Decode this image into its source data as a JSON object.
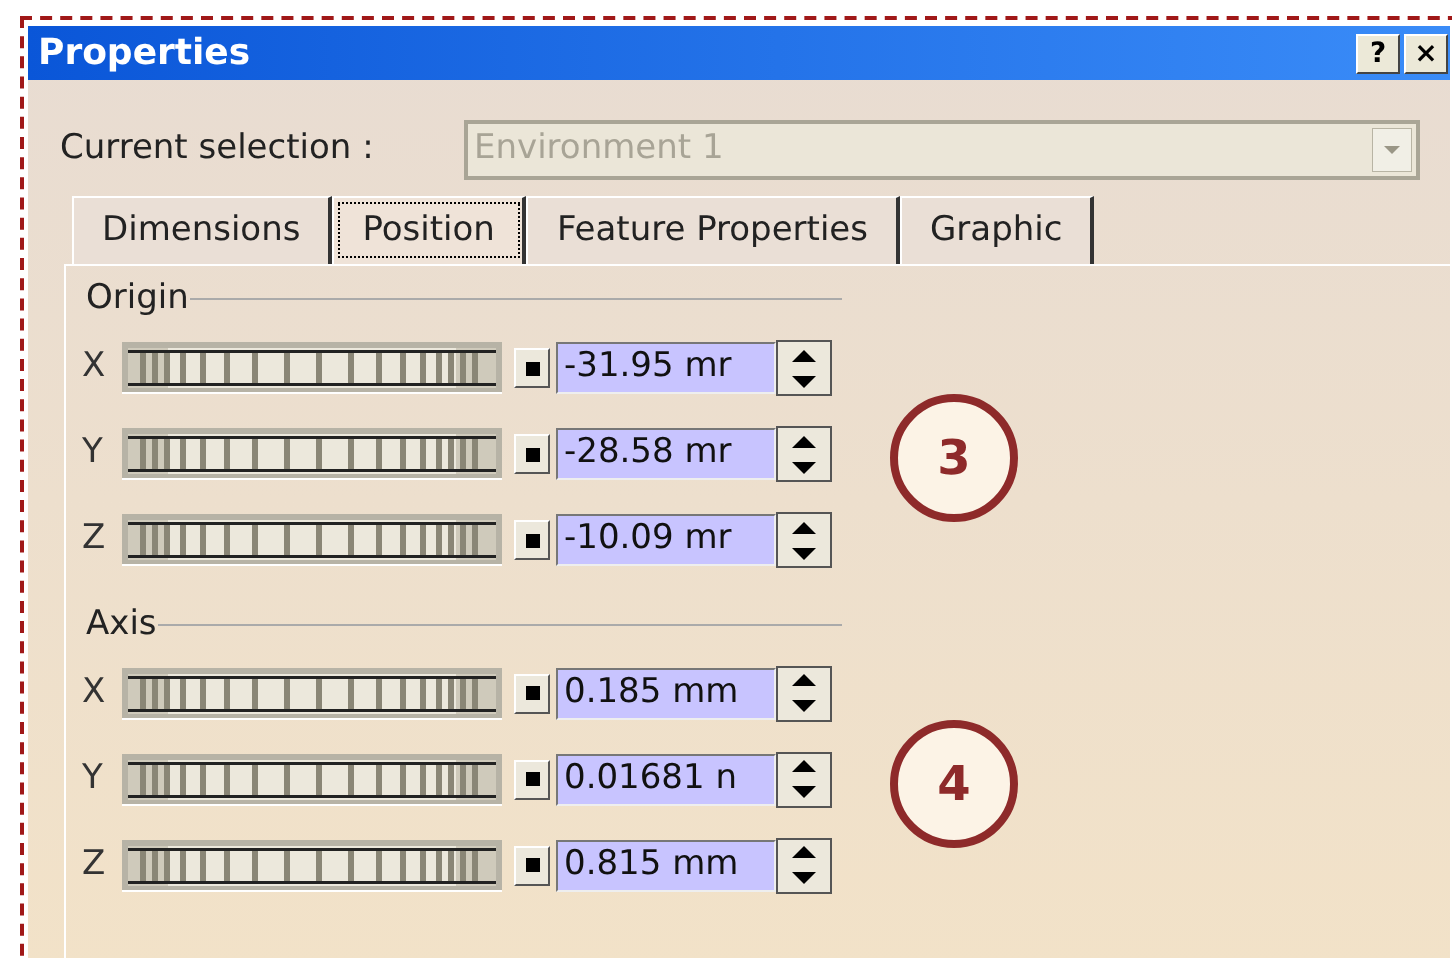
{
  "window": {
    "title": "Properties",
    "buttons": [
      "?",
      "×"
    ]
  },
  "current_selection": {
    "label": "Current selection :",
    "value": "Environment 1",
    "disabled": true
  },
  "tabs": [
    {
      "label": "Dimensions",
      "selected": false
    },
    {
      "label": "Position",
      "selected": true
    },
    {
      "label": "Feature Properties",
      "selected": false
    },
    {
      "label": "Graphic",
      "selected": false
    }
  ],
  "groups": [
    {
      "title": "Origin",
      "callout": "3",
      "rows": [
        {
          "axis": "X",
          "value": "-31.95 mr"
        },
        {
          "axis": "Y",
          "value": "-28.58 mr"
        },
        {
          "axis": "Z",
          "value": "-10.09 mr"
        }
      ]
    },
    {
      "title": "Axis",
      "callout": "4",
      "rows": [
        {
          "axis": "X",
          "value": "0.185 mm"
        },
        {
          "axis": "Y",
          "value": "0.01681 n"
        },
        {
          "axis": "Z",
          "value": "0.815 mm"
        }
      ]
    }
  ]
}
